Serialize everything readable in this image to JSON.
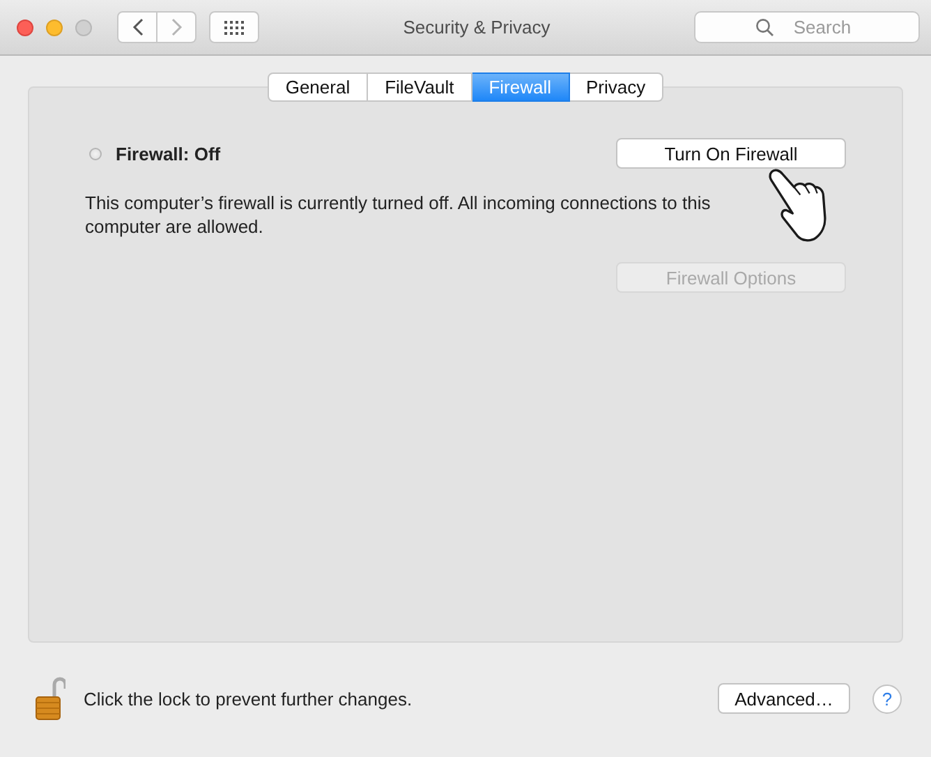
{
  "window": {
    "title": "Security & Privacy"
  },
  "toolbar": {
    "search": {
      "placeholder": "Search"
    }
  },
  "tabs": [
    {
      "label": "General",
      "selected": false
    },
    {
      "label": "FileVault",
      "selected": false
    },
    {
      "label": "Firewall",
      "selected": true
    },
    {
      "label": "Privacy",
      "selected": false
    }
  ],
  "firewall": {
    "on": false,
    "status": "Firewall: Off",
    "description": "This computer’s firewall is currently turned off. All incoming connections to this computer are allowed.",
    "toggle_button": "Turn On Firewall",
    "options_button": {
      "label": "Firewall Options",
      "disabled": true
    }
  },
  "footer": {
    "locked": false,
    "lock_text": "Click the lock to prevent further changes.",
    "advanced_button": "Advanced…",
    "help_button": "?"
  }
}
